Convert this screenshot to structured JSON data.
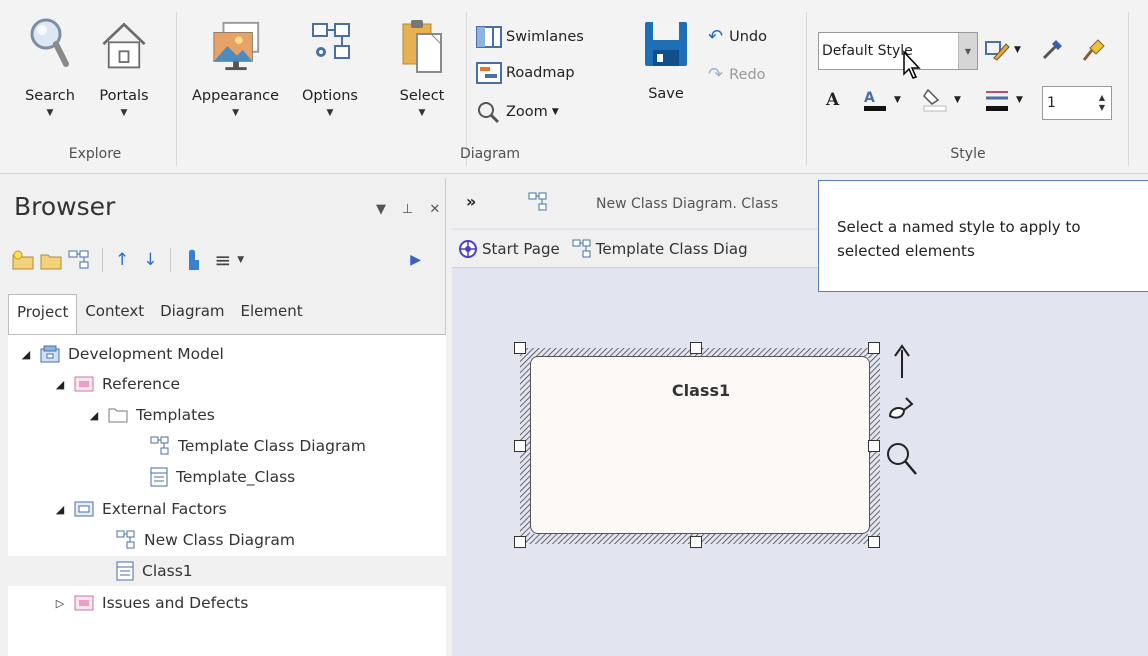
{
  "ribbon": {
    "groups": {
      "explore": "Explore",
      "diagram": "Diagram",
      "style": "Style"
    },
    "search_label": "Search",
    "portals_label": "Portals",
    "appearance_label": "Appearance",
    "options_label": "Options",
    "select_label": "Select",
    "swimlanes_label": "Swimlanes",
    "roadmap_label": "Roadmap",
    "zoom_label": "Zoom",
    "save_label": "Save",
    "undo_label": "Undo",
    "redo_label": "Redo",
    "style_combo_value": "Default Style",
    "line_width_value": "1"
  },
  "tooltip": {
    "text": "Select a named style to apply to selected elements"
  },
  "browser": {
    "title": "Browser",
    "tabs": [
      "Project",
      "Context",
      "Diagram",
      "Element"
    ],
    "tree": [
      {
        "label": "Development Model"
      },
      {
        "label": "Reference"
      },
      {
        "label": "Templates"
      },
      {
        "label": "Template Class Diagram"
      },
      {
        "label": "Template_Class"
      },
      {
        "label": "External Factors"
      },
      {
        "label": "New Class Diagram"
      },
      {
        "label": "Class1"
      },
      {
        "label": "Issues and Defects"
      }
    ]
  },
  "diagram": {
    "header_title": "New Class Diagram.  Class",
    "tabs": [
      "Start Page",
      "Template Class Diag"
    ],
    "class_name": "Class1"
  },
  "colors": {
    "accent": "#2b6cb0",
    "package_pink": "#e9a0c8",
    "folder_yellow": "#f3d27a",
    "canvas": "#e2e5ef"
  }
}
